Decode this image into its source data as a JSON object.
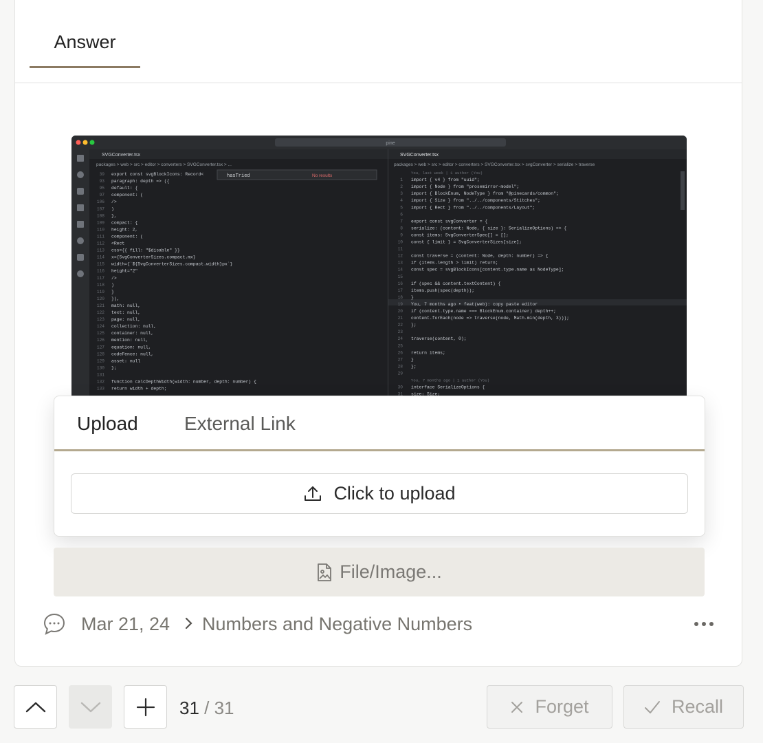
{
  "tabs": {
    "answer_label": "Answer"
  },
  "screenshot": {
    "search_bar": "pine",
    "left_tab": "SVGConverter.tsx",
    "right_tab": "SVGConverter.tsx",
    "left_breadcrumb": "packages > web > src > editor > converters > SVGConverter.tsx > ...",
    "right_breadcrumb": "packages > web > src > editor > converters > SVGConverter.tsx > svgConverter > serialize > traverse",
    "find_value": "hasTried",
    "find_result": "No results",
    "left_lines": [
      {
        "n": "39",
        "t": "export const svgBlockIcons: Record<"
      },
      {
        "n": "93",
        "t": "  paragraph: depth => ({"
      },
      {
        "n": "95",
        "t": "    default: {"
      },
      {
        "n": "97",
        "t": "      component: ("
      },
      {
        "n": "106",
        "t": "        />"
      },
      {
        "n": "107",
        "t": "      )"
      },
      {
        "n": "108",
        "t": "    },"
      },
      {
        "n": "109",
        "t": "    compact: {"
      },
      {
        "n": "110",
        "t": "      height: 2,"
      },
      {
        "n": "111",
        "t": "      component: ("
      },
      {
        "n": "112",
        "t": "        <Rect"
      },
      {
        "n": "113",
        "t": "          css={{ fill: \"$disable\" }}"
      },
      {
        "n": "114",
        "t": "          x={SvgConverterSizes.compact.mx}"
      },
      {
        "n": "115",
        "t": "          width={`${SvgConverterSizes.compact.width}px`}"
      },
      {
        "n": "116",
        "t": "          height=\"2\""
      },
      {
        "n": "117",
        "t": "        />"
      },
      {
        "n": "118",
        "t": "      )"
      },
      {
        "n": "119",
        "t": "    }"
      },
      {
        "n": "120",
        "t": "  }),"
      },
      {
        "n": "121",
        "t": "  math: null,"
      },
      {
        "n": "122",
        "t": "  text: null,"
      },
      {
        "n": "123",
        "t": "  page: null,"
      },
      {
        "n": "124",
        "t": "  collection: null,"
      },
      {
        "n": "125",
        "t": "  container: null,"
      },
      {
        "n": "126",
        "t": "  mention: null,"
      },
      {
        "n": "127",
        "t": "  equation: null,"
      },
      {
        "n": "128",
        "t": "  codeFence: null,"
      },
      {
        "n": "129",
        "t": "  asset: null"
      },
      {
        "n": "130",
        "t": "};"
      },
      {
        "n": "131",
        "t": ""
      },
      {
        "n": "132",
        "t": "function calcDepthWidth(width: number, depth: number) {"
      },
      {
        "n": "133",
        "t": "  return width + depth;"
      }
    ],
    "right_lines": [
      {
        "n": "",
        "t": "You, last week | 1 author (You)"
      },
      {
        "n": "1",
        "t": "import { v4 } from \"uuid\";"
      },
      {
        "n": "2",
        "t": "import { Node } from \"prosemirror-model\";"
      },
      {
        "n": "3",
        "t": "import { BlockEnum, NodeType } from \"@pinecards/common\";"
      },
      {
        "n": "4",
        "t": "import { Size } from \"../../components/Stitches\";"
      },
      {
        "n": "5",
        "t": "import { Rect } from \"../../components/Layout\";"
      },
      {
        "n": "6",
        "t": ""
      },
      {
        "n": "7",
        "t": "export const svgConverter = {"
      },
      {
        "n": "8",
        "t": "  serialize: (content: Node, { size }: SerializeOptions) => {"
      },
      {
        "n": "9",
        "t": "    const items: SvgConverterSpec[] = [];"
      },
      {
        "n": "10",
        "t": "    const { limit } = SvgConverterSizes[size];"
      },
      {
        "n": "11",
        "t": ""
      },
      {
        "n": "12",
        "t": "    const traverse = (content: Node, depth: number) => {"
      },
      {
        "n": "13",
        "t": "      if (items.length > limit) return;"
      },
      {
        "n": "14",
        "t": "      const spec = svgBlockIcons[content.type.name as NodeType];"
      },
      {
        "n": "15",
        "t": ""
      },
      {
        "n": "16",
        "t": "      if (spec && content.textContent) {"
      },
      {
        "n": "17",
        "t": "        items.push(spec(depth));"
      },
      {
        "n": "18",
        "t": "      }"
      },
      {
        "n": "19",
        "t": "      You, 7 months ago • feat(web): copy paste editor"
      },
      {
        "n": "20",
        "t": "      if (content.type.name === BlockEnum.container) depth++;"
      },
      {
        "n": "21",
        "t": "      content.forEach(node => traverse(node, Math.min(depth, 3)));"
      },
      {
        "n": "22",
        "t": "    };"
      },
      {
        "n": "23",
        "t": ""
      },
      {
        "n": "24",
        "t": "    traverse(content, 0);"
      },
      {
        "n": "25",
        "t": ""
      },
      {
        "n": "26",
        "t": "    return items;"
      },
      {
        "n": "27",
        "t": "  }"
      },
      {
        "n": "28",
        "t": "};"
      },
      {
        "n": "29",
        "t": ""
      },
      {
        "n": "",
        "t": "You, 7 months ago | 1 author (You)"
      },
      {
        "n": "30",
        "t": "interface SerializeOptions {"
      },
      {
        "n": "31",
        "t": "  size: Size;"
      }
    ]
  },
  "popover": {
    "tab_upload": "Upload",
    "tab_link": "External Link",
    "upload_label": "Click to upload"
  },
  "file_button_label": "File/Image...",
  "meta": {
    "date": "Mar 21, 24",
    "breadcrumb": "Numbers and Negative Numbers"
  },
  "counter": {
    "current": "31",
    "separator": " / ",
    "total": "31"
  },
  "actions": {
    "forget_label": "Forget",
    "recall_label": "Recall"
  },
  "colors": {
    "accent": "#8b7a62",
    "editor_bg": "#1e1f22"
  }
}
